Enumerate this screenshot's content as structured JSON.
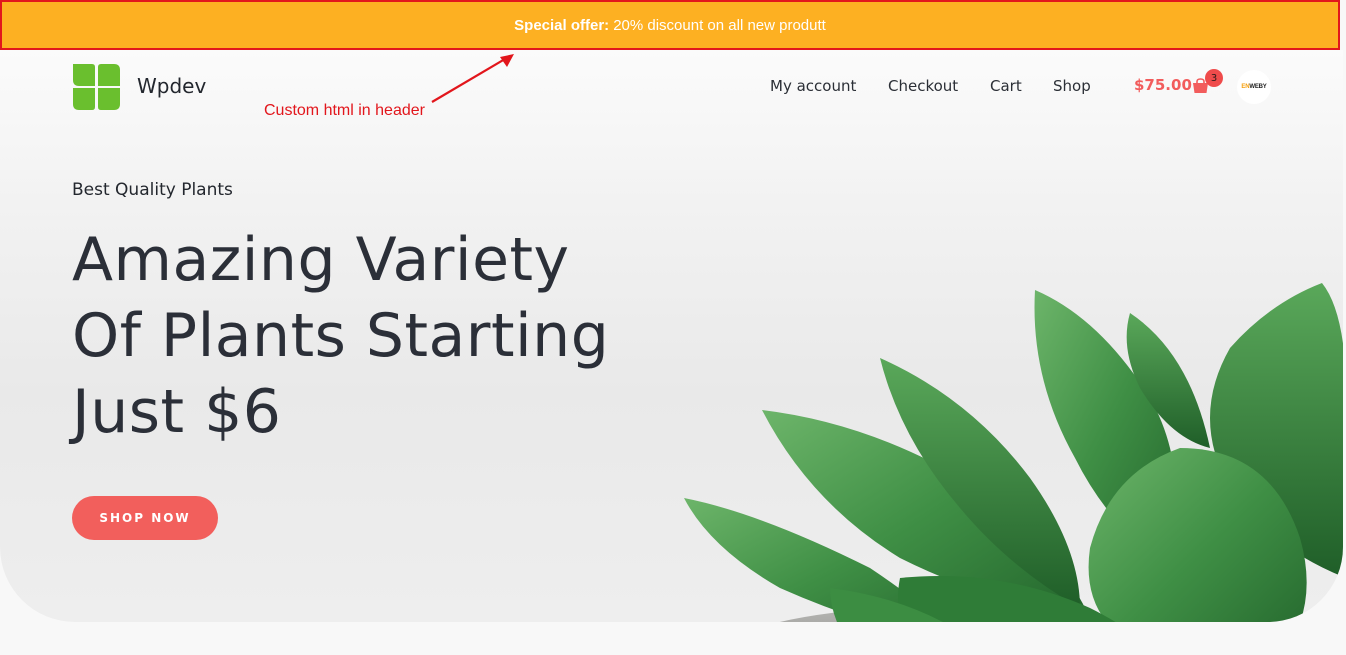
{
  "topbar": {
    "label": "Special offer:",
    "text": "20% discount on all new produtt"
  },
  "header": {
    "brand": "Wpdev",
    "annotation": "Custom html in header",
    "nav": [
      "My account",
      "Checkout",
      "Cart",
      "Shop"
    ],
    "cart_total": "$75.00",
    "cart_count": "3",
    "avatar": {
      "accent": "EN",
      "rest": "WEBY"
    }
  },
  "hero": {
    "eyebrow": "Best Quality Plants",
    "headline": [
      "Amazing Variety",
      "Of Plants Starting",
      "Just $6"
    ],
    "cta": "SHOP NOW"
  },
  "colors": {
    "topbar_bg": "#fdb022",
    "annotation": "#e2161c",
    "accent": "#f25f5c",
    "logo_green": "#6abf2e",
    "text": "#2b2f36"
  }
}
